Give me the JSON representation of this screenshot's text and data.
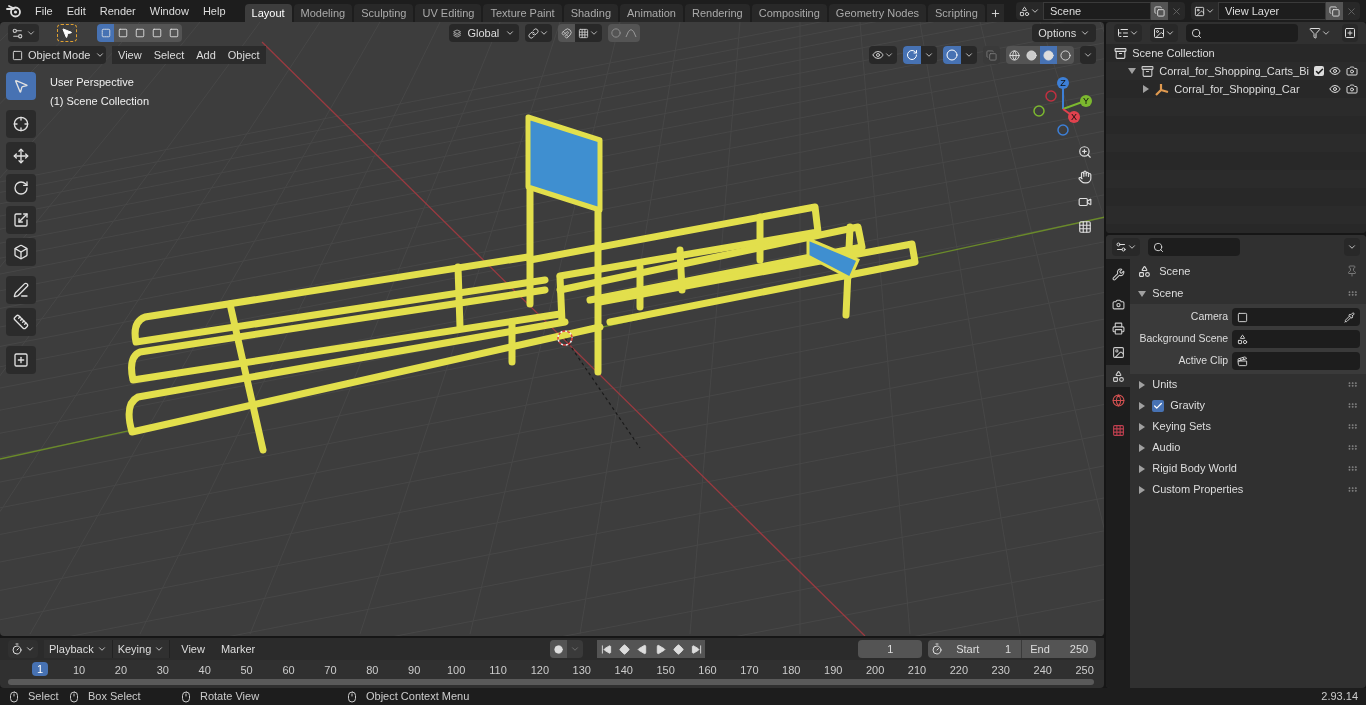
{
  "menu": [
    "File",
    "Edit",
    "Render",
    "Window",
    "Help"
  ],
  "workspaces": [
    {
      "label": "Layout",
      "selected": true
    },
    {
      "label": "Modeling",
      "selected": false
    },
    {
      "label": "Sculpting",
      "selected": false
    },
    {
      "label": "UV Editing",
      "selected": false
    },
    {
      "label": "Texture Paint",
      "selected": false
    },
    {
      "label": "Shading",
      "selected": false
    },
    {
      "label": "Animation",
      "selected": false
    },
    {
      "label": "Rendering",
      "selected": false
    },
    {
      "label": "Compositing",
      "selected": false
    },
    {
      "label": "Geometry Nodes",
      "selected": false
    },
    {
      "label": "Scripting",
      "selected": false
    }
  ],
  "scene": {
    "value": "Scene"
  },
  "view_layer": {
    "value": "View Layer"
  },
  "viewport": {
    "select_modes": [
      {
        "selected": true
      },
      {
        "selected": false
      },
      {
        "selected": false
      },
      {
        "selected": false
      },
      {
        "selected": false
      }
    ],
    "transform_orientation": "Global",
    "options": "Options",
    "mode": "Object Mode",
    "menu": [
      "View",
      "Select",
      "Add",
      "Object"
    ],
    "proportional_editing": false,
    "gizmos": true,
    "overlays": true,
    "overlay_text": [
      "User Perspective",
      "(1) Scene Collection"
    ],
    "tools": [
      {
        "selected": true
      },
      {
        "selected": false
      },
      {
        "selected": false
      },
      {
        "selected": false
      },
      {
        "selected": false
      },
      {
        "selected": false
      },
      {
        "selected": false
      },
      {
        "selected": false
      },
      {
        "selected": false
      }
    ],
    "shading": [
      {
        "selected": false
      },
      {
        "selected": false
      },
      {
        "selected": true
      },
      {
        "selected": false
      }
    ],
    "gizmo_axes": [
      "Z",
      "Y",
      "X"
    ]
  },
  "outliner": {
    "items": [
      {
        "label": "Scene Collection",
        "kind": "scene",
        "children": [
          {
            "label": "Corral_for_Shopping_Carts_Bi",
            "kind": "collection",
            "expanded": true,
            "checked": true,
            "children": [
              {
                "label": "Corral_for_Shopping_Car",
                "kind": "object",
                "expanded": false
              }
            ]
          }
        ]
      }
    ]
  },
  "properties": {
    "tabs": [
      {
        "selected": false
      },
      {
        "selected": false
      },
      {
        "selected": false
      },
      {
        "selected": false
      },
      {
        "selected": true
      },
      {
        "selected": false
      },
      {
        "selected": false
      }
    ],
    "context": "Scene",
    "panels": [
      {
        "label": "Scene",
        "expanded": true,
        "fields": [
          {
            "label": "Camera",
            "kind": "camera"
          },
          {
            "label": "Background Scene",
            "kind": "scene"
          },
          {
            "label": "Active Clip",
            "kind": "clip"
          }
        ]
      },
      {
        "label": "Units",
        "expanded": false
      },
      {
        "label": "Gravity",
        "expanded": false,
        "checked": true
      },
      {
        "label": "Keying Sets",
        "expanded": false
      },
      {
        "label": "Audio",
        "expanded": false
      },
      {
        "label": "Rigid Body World",
        "expanded": false
      },
      {
        "label": "Custom Properties",
        "expanded": false
      }
    ]
  },
  "timeline": {
    "dropdowns": [
      "Playback",
      "Keying"
    ],
    "menu": [
      "View",
      "Marker"
    ],
    "auto_keying": false,
    "current_frame": "1",
    "start_label": "Start",
    "start": "1",
    "end_label": "End",
    "end": "250",
    "playhead": "1",
    "ruler": [
      "10",
      "20",
      "30",
      "40",
      "50",
      "60",
      "70",
      "80",
      "90",
      "100",
      "110",
      "120",
      "130",
      "140",
      "150",
      "160",
      "170",
      "180",
      "190",
      "200",
      "210",
      "220",
      "230",
      "240",
      "250"
    ]
  },
  "status": {
    "hints": [
      "Select",
      "Box Select",
      "Rotate View",
      "Object Context Menu"
    ],
    "version": "2.93.14"
  }
}
